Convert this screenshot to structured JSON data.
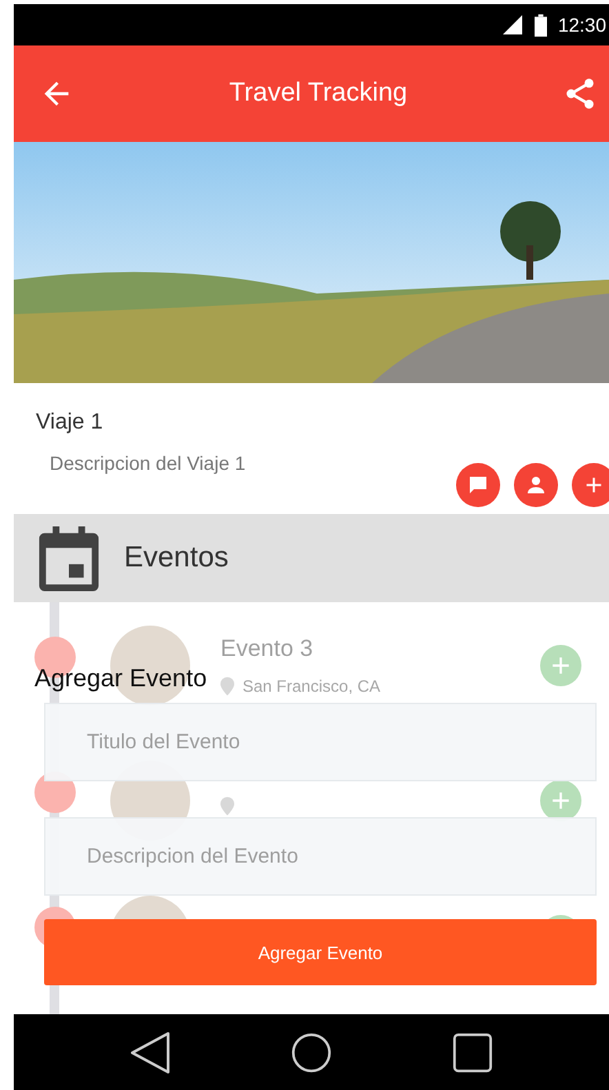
{
  "status_bar": {
    "time": "12:30"
  },
  "app_bar": {
    "title": "Travel Tracking"
  },
  "trip": {
    "title": "Viaje 1",
    "description": "Descripcion del Viaje 1"
  },
  "events_section": {
    "title": "Eventos",
    "events": [
      {
        "title": "Evento 3",
        "location": "San Francisco, CA",
        "photo": true
      },
      {
        "photo": true
      },
      {
        "photo": true
      }
    ]
  },
  "dialog": {
    "title": "Agregar Evento",
    "fields": [
      {
        "placeholder": "Titulo del Evento"
      },
      {
        "placeholder": "Descripcion del Evento"
      }
    ],
    "button": "Agregar Evento"
  }
}
